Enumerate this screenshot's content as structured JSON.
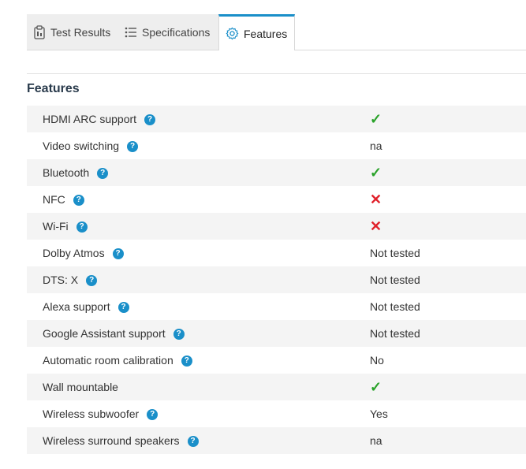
{
  "tabs": [
    {
      "label": "Test Results",
      "icon": "clipboard-icon",
      "active": false
    },
    {
      "label": "Specifications",
      "icon": "list-icon",
      "active": false
    },
    {
      "label": "Features",
      "icon": "gear-icon",
      "active": true
    }
  ],
  "section_title": "Features",
  "colors": {
    "accent": "#1a8fc9",
    "check": "#2aa22a",
    "cross": "#e0202a"
  },
  "rows": [
    {
      "label": "HDMI ARC support",
      "help": "?",
      "value_type": "check",
      "value": "✓"
    },
    {
      "label": "Video switching",
      "help": "?",
      "value_type": "text",
      "value": "na"
    },
    {
      "label": "Bluetooth",
      "help": "?",
      "value_type": "check",
      "value": "✓"
    },
    {
      "label": "NFC",
      "help": "?",
      "value_type": "cross",
      "value": "✕"
    },
    {
      "label": "Wi-Fi",
      "help": "?",
      "value_type": "cross",
      "value": "✕"
    },
    {
      "label": "Dolby Atmos",
      "help": "?",
      "value_type": "text",
      "value": "Not tested"
    },
    {
      "label": "DTS: X",
      "help": "?",
      "value_type": "text",
      "value": "Not tested"
    },
    {
      "label": "Alexa support",
      "help": "?",
      "value_type": "text",
      "value": "Not tested"
    },
    {
      "label": "Google Assistant support",
      "help": "?",
      "value_type": "text",
      "value": "Not tested"
    },
    {
      "label": "Automatic room calibration",
      "help": "?",
      "value_type": "text",
      "value": "No"
    },
    {
      "label": "Wall mountable",
      "help": "",
      "value_type": "check",
      "value": "✓"
    },
    {
      "label": "Wireless subwoofer",
      "help": "?",
      "value_type": "text",
      "value": "Yes"
    },
    {
      "label": "Wireless surround speakers",
      "help": "?",
      "value_type": "text",
      "value": "na"
    }
  ]
}
